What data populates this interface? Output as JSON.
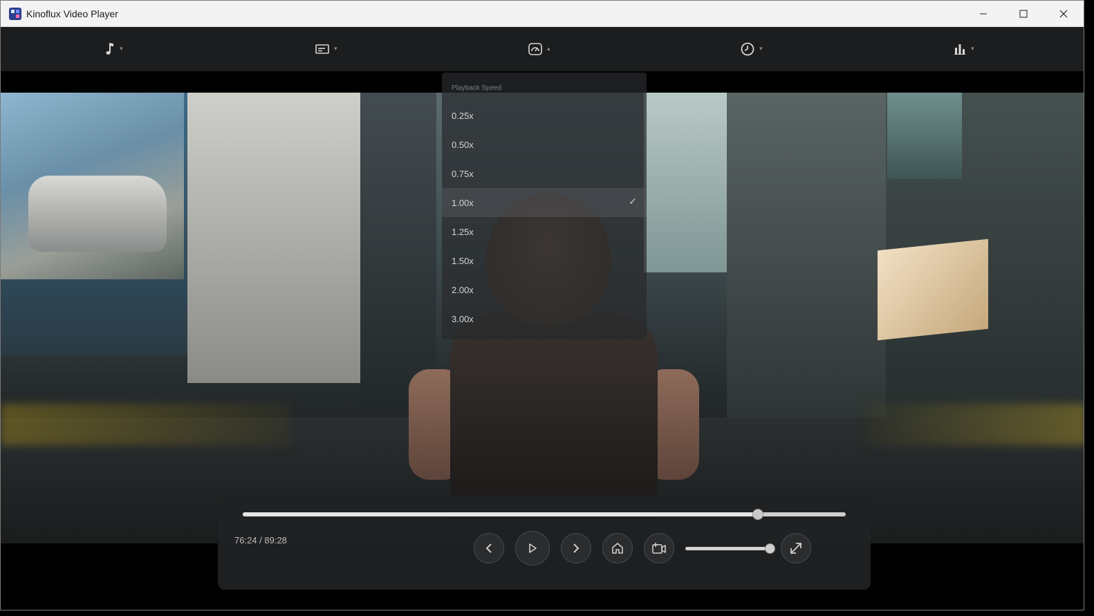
{
  "window": {
    "title": "Kinoflux Video Player",
    "app_icon": "kinoflux-logo-icon",
    "controls": [
      "minimize-icon",
      "maximize-icon",
      "close-icon"
    ]
  },
  "toolbar": {
    "items": [
      {
        "name": "audio-track",
        "icon": "music-note-icon",
        "caret": "▾"
      },
      {
        "name": "subtitles",
        "icon": "subtitles-icon",
        "caret": "▾"
      },
      {
        "name": "playback-speed",
        "icon": "speedometer-icon",
        "caret": "▴"
      },
      {
        "name": "history",
        "icon": "history-clock-icon",
        "caret": "▾"
      },
      {
        "name": "statistics",
        "icon": "bar-chart-icon",
        "caret": "▾"
      }
    ]
  },
  "speed_menu": {
    "header": "Playback Speed",
    "options": [
      "0.25x",
      "0.50x",
      "0.75x",
      "1.00x",
      "1.25x",
      "1.50x",
      "2.00x",
      "3.00x"
    ],
    "selected": "1.00x",
    "check": "✓"
  },
  "player": {
    "time_display": "76:24 / 89:28",
    "current_seconds": 4584,
    "duration_seconds": 5368,
    "progress_fraction": 0.854,
    "volume_fraction": 0.98,
    "buttons": [
      "previous-icon",
      "play-icon",
      "next-icon",
      "home-icon",
      "snapshot-icon",
      "fullscreen-icon"
    ]
  },
  "colors": {
    "title_bar": "#f3f3f3",
    "toolbar": "#1c1d1e",
    "panel": "#202224",
    "accent": "#cfcfcf"
  }
}
